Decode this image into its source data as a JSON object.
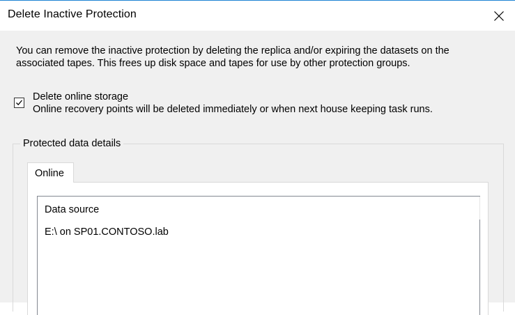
{
  "window": {
    "title": "Delete Inactive Protection",
    "close_icon": "close-icon"
  },
  "description": {
    "line1": "You can remove the inactive protection by deleting the replica and/or expiring the datasets on the",
    "line2": "associated tapes. This frees up disk space and tapes for use by other protection groups."
  },
  "delete_online_storage": {
    "label": "Delete online storage",
    "description": "Online recovery points will be deleted immediately or when next house keeping task runs.",
    "checked": true
  },
  "protected_data": {
    "group_label": "Protected data details",
    "tabs": [
      {
        "label": "Online",
        "selected": true
      }
    ],
    "list": {
      "header": "Data source",
      "items": [
        {
          "text": "E:\\ on SP01.CONTOSO.lab"
        }
      ]
    }
  }
}
